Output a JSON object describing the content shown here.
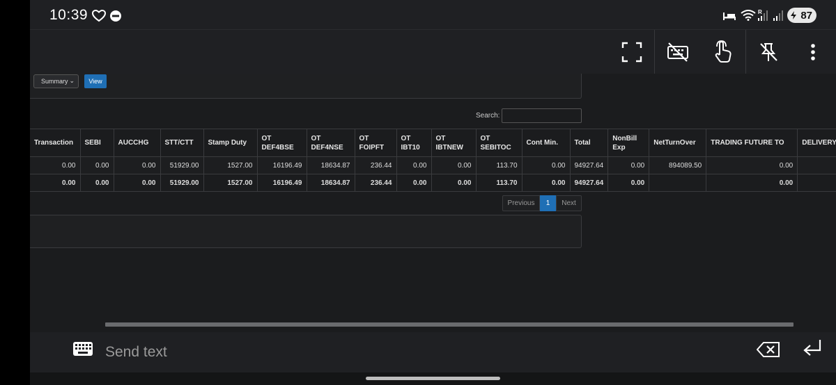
{
  "status_bar": {
    "time": "10:39",
    "battery": "87",
    "icons": [
      "heart-shield-icon",
      "app-badge-icon",
      "bed-icon",
      "wifi-icon",
      "signal-r-icon",
      "signal-icon",
      "battery-icon"
    ]
  },
  "toolbar": {
    "icons": [
      "fullscreen-icon",
      "keyboard-off-icon",
      "touch-icon",
      "unpin-icon",
      "more-vert-icon"
    ]
  },
  "filters": {
    "report_select": "Summary",
    "view_button": "View"
  },
  "search": {
    "label": "Search:",
    "value": ""
  },
  "table": {
    "headers": [
      [
        "Transaction"
      ],
      [
        "SEBI"
      ],
      [
        "AUCCHG"
      ],
      [
        "STT/CTT"
      ],
      [
        "Stamp Duty"
      ],
      [
        "OT",
        "DEF4BSE"
      ],
      [
        "OT",
        "DEF4NSE"
      ],
      [
        "OT",
        "FOIPFT"
      ],
      [
        "OT",
        "IBT10"
      ],
      [
        "OT",
        "IBTNEW"
      ],
      [
        "OT",
        "SEBITOC"
      ],
      [
        "Cont Min."
      ],
      [
        "Total"
      ],
      [
        "NonBill",
        "Exp"
      ],
      [
        "NetTurnOver"
      ],
      [
        "TRADING FUTURE TO"
      ],
      [
        "DELIVERY"
      ]
    ],
    "rows": [
      [
        "0.00",
        "0.00",
        "0.00",
        "51929.00",
        "1527.00",
        "16196.49",
        "18634.87",
        "236.44",
        "0.00",
        "0.00",
        "113.70",
        "0.00",
        "94927.64",
        "0.00",
        "894089.50",
        "0.00",
        ""
      ]
    ],
    "total_row": [
      "0.00",
      "0.00",
      "0.00",
      "51929.00",
      "1527.00",
      "16196.49",
      "18634.87",
      "236.44",
      "0.00",
      "0.00",
      "113.70",
      "0.00",
      "94927.64",
      "0.00",
      "",
      "0.00",
      ""
    ]
  },
  "pagination": {
    "previous": "Previous",
    "current": "1",
    "next": "Next"
  },
  "input_bar": {
    "placeholder": "Send text",
    "icons": [
      "keyboard-icon",
      "backspace-icon",
      "enter-icon"
    ]
  }
}
